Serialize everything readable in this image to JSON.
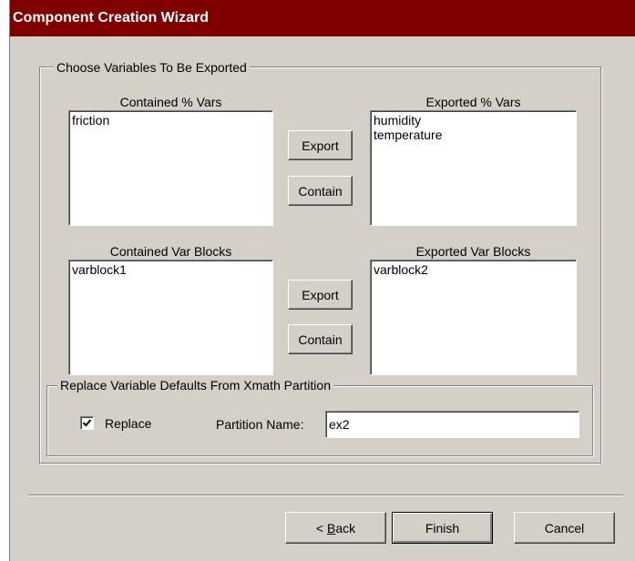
{
  "window": {
    "title": "Component Creation Wizard"
  },
  "export_group": {
    "legend": "Choose Variables To Be Exported",
    "contained_vars": {
      "label": "Contained % Vars",
      "items": [
        "friction"
      ]
    },
    "exported_vars": {
      "label": "Exported % Vars",
      "items": [
        "humidity",
        "temperature"
      ]
    },
    "contained_blocks": {
      "label": "Contained Var Blocks",
      "items": [
        "varblock1"
      ]
    },
    "exported_blocks": {
      "label": "Exported Var Blocks",
      "items": [
        "varblock2"
      ]
    },
    "vars_buttons": {
      "export": "Export",
      "contain": "Contain"
    },
    "blocks_buttons": {
      "export": "Export",
      "contain": "Contain"
    }
  },
  "replace_group": {
    "legend": "Replace Variable Defaults From Xmath Partition",
    "checkbox_label": "Replace",
    "checked": true,
    "partition_label": "Partition Name:",
    "partition_value": "ex2"
  },
  "footer": {
    "back_prefix": "< ",
    "back_accel": "B",
    "back_rest": "ack",
    "finish": "Finish",
    "cancel": "Cancel"
  },
  "colors": {
    "titlebar": "#800000",
    "dialog_face": "#d4d0c8"
  }
}
